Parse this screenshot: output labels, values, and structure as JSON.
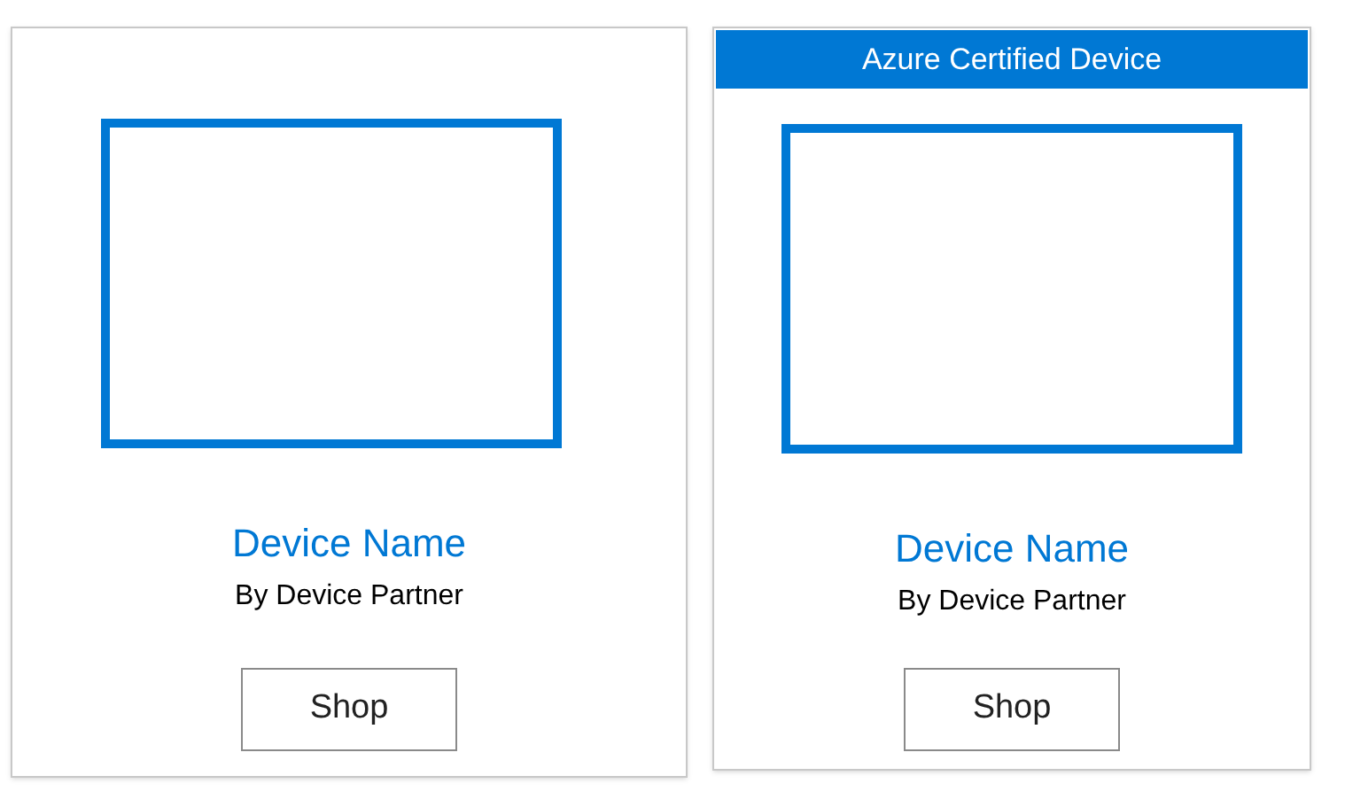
{
  "cards": [
    {
      "title": "Device Name",
      "subtitle": "By Device Partner",
      "button": "Shop"
    },
    {
      "badge": "Azure Certified Device",
      "title": "Device Name",
      "subtitle": "By Device Partner",
      "button": "Shop"
    }
  ]
}
